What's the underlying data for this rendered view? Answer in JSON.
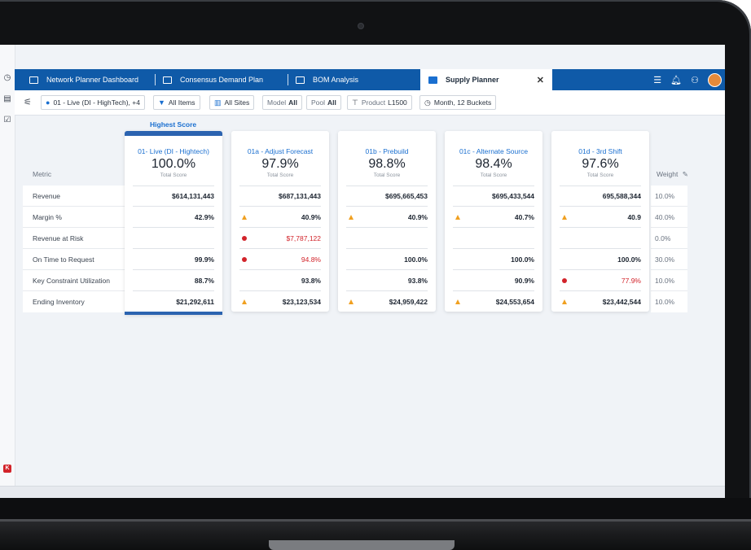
{
  "tabs": [
    {
      "label": "Network Planner Dashboard"
    },
    {
      "label": "Consensus Demand Plan"
    },
    {
      "label": "BOM Analysis"
    },
    {
      "label": "Supply Planner"
    }
  ],
  "active_tab_close": "✕",
  "toolbar": {
    "scenario": "01 - Live (DI - HighTech), +4",
    "items": "All Items",
    "sites": "All Sites",
    "model_key": "Model",
    "model_val": "All",
    "pool_key": "Pool",
    "pool_val": "All",
    "product_key": "Product",
    "product_val": "L1500",
    "time": "Month, 12 Buckets"
  },
  "highest_score_label": "Highest Score",
  "metric_header": "Metric",
  "weight_header": "Weight",
  "metrics": [
    "Revenue",
    "Margin %",
    "Revenue at Risk",
    "On Time to Request",
    "Key Constraint Utilization",
    "Ending Inventory"
  ],
  "weights": [
    "10.0%",
    "40.0%",
    "0.0%",
    "30.0%",
    "10.0%",
    "10.0%"
  ],
  "total_score_label": "Total Score",
  "scenarios": [
    {
      "name": "01- Live (DI - Hightech)",
      "score": "100.0%",
      "values": [
        "$614,131,443",
        "42.9%",
        "",
        "99.9%",
        "88.7%",
        "$21,292,611"
      ],
      "flags": [
        "",
        "",
        "",
        "",
        "",
        ""
      ],
      "red": [
        false,
        false,
        false,
        false,
        false,
        false
      ]
    },
    {
      "name": "01a - Adjust Forecast",
      "score": "97.9%",
      "values": [
        "$687,131,443",
        "40.9%",
        "$7,787,122",
        "94.8%",
        "93.8%",
        "$23,123,534"
      ],
      "flags": [
        "",
        "warn",
        "alert",
        "alert",
        "",
        "warn"
      ],
      "red": [
        false,
        false,
        true,
        true,
        false,
        false
      ]
    },
    {
      "name": "01b - Prebuild",
      "score": "98.8%",
      "values": [
        "$695,665,453",
        "40.9%",
        "",
        "100.0%",
        "93.8%",
        "$24,959,422"
      ],
      "flags": [
        "",
        "warn",
        "",
        "",
        "",
        "warn"
      ],
      "red": [
        false,
        false,
        false,
        false,
        false,
        false
      ]
    },
    {
      "name": "01c - Alternate Source",
      "score": "98.4%",
      "values": [
        "$695,433,544",
        "40.7%",
        "",
        "100.0%",
        "90.9%",
        "$24,553,654"
      ],
      "flags": [
        "",
        "warn",
        "",
        "",
        "",
        "warn"
      ],
      "red": [
        false,
        false,
        false,
        false,
        false,
        false
      ]
    },
    {
      "name": "01d - 3rd Shift",
      "score": "97.6%",
      "values": [
        "695,588,344",
        "40.9",
        "",
        "100.0%",
        "77.9%",
        "$23,442,544"
      ],
      "flags": [
        "",
        "warn",
        "",
        "",
        "alert",
        "warn"
      ],
      "red": [
        false,
        false,
        false,
        false,
        true,
        false
      ]
    }
  ],
  "colors": {
    "brand": "#0f5aa8",
    "accent": "#1a6fd0",
    "alert": "#d2232a",
    "warn": "#f0a020"
  }
}
